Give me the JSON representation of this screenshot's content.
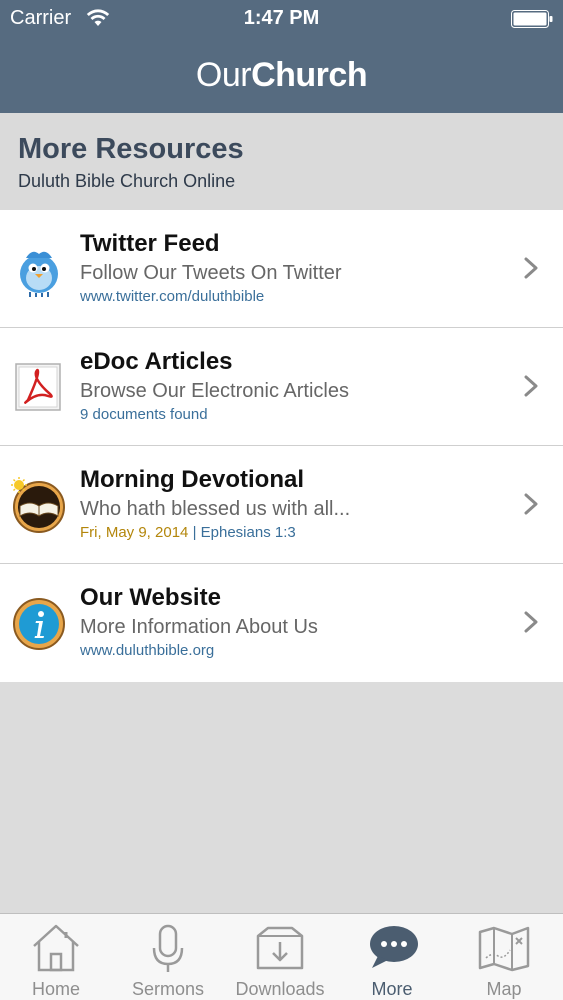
{
  "status_bar": {
    "carrier": "Carrier",
    "time": "1:47 PM"
  },
  "nav_bar": {
    "title_light": "Our",
    "title_bold": "Church"
  },
  "section": {
    "heading": "More Resources",
    "subtitle": "Duluth Bible Church Online"
  },
  "items": [
    {
      "icon": "twitter-bird-icon",
      "title": "Twitter Feed",
      "description": "Follow Our Tweets On Twitter",
      "meta": "www.twitter.com/duluthbible"
    },
    {
      "icon": "pdf-document-icon",
      "title": "eDoc Articles",
      "description": "Browse Our Electronic Articles",
      "meta": "9 documents found"
    },
    {
      "icon": "open-bible-icon",
      "title": "Morning Devotional",
      "description": "Who hath blessed us with all...",
      "meta_date": "Fri, May 9, 2014",
      "meta_separator": "|",
      "meta_ref": "Ephesians 1:3"
    },
    {
      "icon": "info-icon",
      "title": "Our Website",
      "description": "More Information About Us",
      "meta": "www.duluthbible.org"
    }
  ],
  "tabs": [
    {
      "label": "Home",
      "icon": "home-icon",
      "active": false
    },
    {
      "label": "Sermons",
      "icon": "microphone-icon",
      "active": false
    },
    {
      "label": "Downloads",
      "icon": "download-icon",
      "active": false
    },
    {
      "label": "More",
      "icon": "more-icon",
      "active": true
    },
    {
      "label": "Map",
      "icon": "map-icon",
      "active": false
    }
  ],
  "colors": {
    "nav": "#566b80",
    "accent": "#4b5d70",
    "link": "#3a6f9a",
    "date": "#b3860b"
  }
}
